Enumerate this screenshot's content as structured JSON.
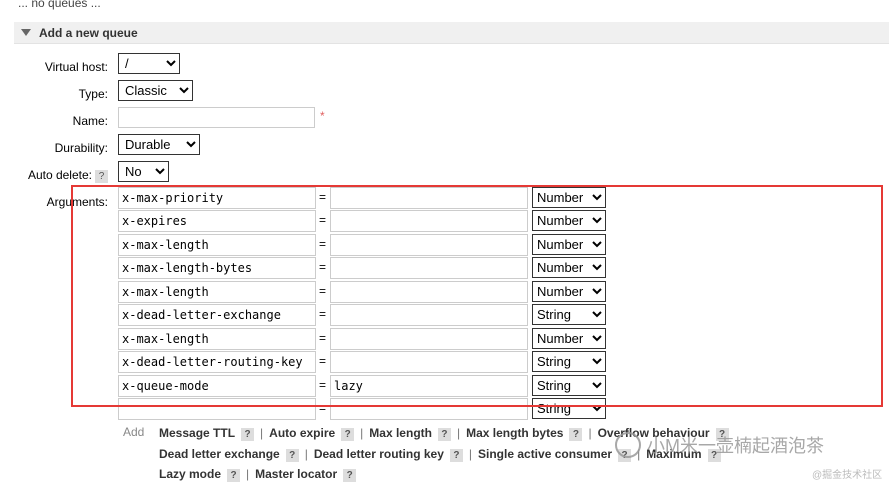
{
  "top_text": "... no queues ...",
  "section": {
    "title": "Add a new queue"
  },
  "form": {
    "virtual_host": {
      "label": "Virtual host:",
      "value": "/"
    },
    "type": {
      "label": "Type:",
      "value": "Classic"
    },
    "name": {
      "label": "Name:",
      "value": "",
      "required_mark": "*"
    },
    "durability": {
      "label": "Durability:",
      "value": "Durable"
    },
    "auto_delete": {
      "label": "Auto delete:",
      "help": "?",
      "value": "No"
    },
    "arguments_label": "Arguments:"
  },
  "arguments": [
    {
      "key": "x-max-priority",
      "eq": "=",
      "value": "",
      "type": "Number"
    },
    {
      "key": "x-expires",
      "eq": "=",
      "value": "",
      "type": "Number"
    },
    {
      "key": "x-max-length",
      "eq": "=",
      "value": "",
      "type": "Number"
    },
    {
      "key": "x-max-length-bytes",
      "eq": "=",
      "value": "",
      "type": "Number"
    },
    {
      "key": "x-max-length",
      "eq": "=",
      "value": "",
      "type": "Number"
    },
    {
      "key": "x-dead-letter-exchange",
      "eq": "=",
      "value": "",
      "type": "String"
    },
    {
      "key": "x-max-length",
      "eq": "=",
      "value": "",
      "type": "Number"
    },
    {
      "key": "x-dead-letter-routing-key",
      "eq": "=",
      "value": "",
      "type": "String"
    },
    {
      "key": "x-queue-mode",
      "eq": "=",
      "value": "lazy",
      "type": "String"
    },
    {
      "key": "",
      "eq": "=",
      "value": "",
      "type": "String"
    }
  ],
  "shortcuts": {
    "add_label": "Add",
    "help": "?",
    "line1": [
      "Message TTL",
      "Auto expire",
      "Max length",
      "Max length bytes",
      "Overflow behaviour"
    ],
    "line2": [
      "Dead letter exchange",
      "Dead letter routing key",
      "Single active consumer",
      "Maximum"
    ],
    "line3": [
      "Lazy mode",
      "Master locator"
    ]
  },
  "watermark": "小M米一壶楠起酒泡茶",
  "site_mark": "@掘金技术社区",
  "colors": {
    "highlight": "#e53935",
    "header_bg": "#f0f0f0"
  }
}
